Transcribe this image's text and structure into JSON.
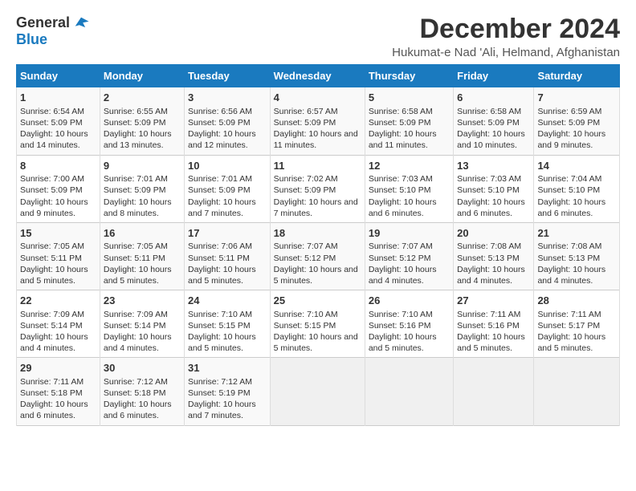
{
  "logo": {
    "line1": "General",
    "line2": "Blue"
  },
  "title": "December 2024",
  "subtitle": "Hukumat-e Nad 'Ali, Helmand, Afghanistan",
  "days_header": [
    "Sunday",
    "Monday",
    "Tuesday",
    "Wednesday",
    "Thursday",
    "Friday",
    "Saturday"
  ],
  "weeks": [
    [
      {
        "day": "1",
        "sunrise": "6:54 AM",
        "sunset": "5:09 PM",
        "daylight": "10 hours and 14 minutes."
      },
      {
        "day": "2",
        "sunrise": "6:55 AM",
        "sunset": "5:09 PM",
        "daylight": "10 hours and 13 minutes."
      },
      {
        "day": "3",
        "sunrise": "6:56 AM",
        "sunset": "5:09 PM",
        "daylight": "10 hours and 12 minutes."
      },
      {
        "day": "4",
        "sunrise": "6:57 AM",
        "sunset": "5:09 PM",
        "daylight": "10 hours and 11 minutes."
      },
      {
        "day": "5",
        "sunrise": "6:58 AM",
        "sunset": "5:09 PM",
        "daylight": "10 hours and 11 minutes."
      },
      {
        "day": "6",
        "sunrise": "6:58 AM",
        "sunset": "5:09 PM",
        "daylight": "10 hours and 10 minutes."
      },
      {
        "day": "7",
        "sunrise": "6:59 AM",
        "sunset": "5:09 PM",
        "daylight": "10 hours and 9 minutes."
      }
    ],
    [
      {
        "day": "8",
        "sunrise": "7:00 AM",
        "sunset": "5:09 PM",
        "daylight": "10 hours and 9 minutes."
      },
      {
        "day": "9",
        "sunrise": "7:01 AM",
        "sunset": "5:09 PM",
        "daylight": "10 hours and 8 minutes."
      },
      {
        "day": "10",
        "sunrise": "7:01 AM",
        "sunset": "5:09 PM",
        "daylight": "10 hours and 7 minutes."
      },
      {
        "day": "11",
        "sunrise": "7:02 AM",
        "sunset": "5:09 PM",
        "daylight": "10 hours and 7 minutes."
      },
      {
        "day": "12",
        "sunrise": "7:03 AM",
        "sunset": "5:10 PM",
        "daylight": "10 hours and 6 minutes."
      },
      {
        "day": "13",
        "sunrise": "7:03 AM",
        "sunset": "5:10 PM",
        "daylight": "10 hours and 6 minutes."
      },
      {
        "day": "14",
        "sunrise": "7:04 AM",
        "sunset": "5:10 PM",
        "daylight": "10 hours and 6 minutes."
      }
    ],
    [
      {
        "day": "15",
        "sunrise": "7:05 AM",
        "sunset": "5:11 PM",
        "daylight": "10 hours and 5 minutes."
      },
      {
        "day": "16",
        "sunrise": "7:05 AM",
        "sunset": "5:11 PM",
        "daylight": "10 hours and 5 minutes."
      },
      {
        "day": "17",
        "sunrise": "7:06 AM",
        "sunset": "5:11 PM",
        "daylight": "10 hours and 5 minutes."
      },
      {
        "day": "18",
        "sunrise": "7:07 AM",
        "sunset": "5:12 PM",
        "daylight": "10 hours and 5 minutes."
      },
      {
        "day": "19",
        "sunrise": "7:07 AM",
        "sunset": "5:12 PM",
        "daylight": "10 hours and 4 minutes."
      },
      {
        "day": "20",
        "sunrise": "7:08 AM",
        "sunset": "5:13 PM",
        "daylight": "10 hours and 4 minutes."
      },
      {
        "day": "21",
        "sunrise": "7:08 AM",
        "sunset": "5:13 PM",
        "daylight": "10 hours and 4 minutes."
      }
    ],
    [
      {
        "day": "22",
        "sunrise": "7:09 AM",
        "sunset": "5:14 PM",
        "daylight": "10 hours and 4 minutes."
      },
      {
        "day": "23",
        "sunrise": "7:09 AM",
        "sunset": "5:14 PM",
        "daylight": "10 hours and 4 minutes."
      },
      {
        "day": "24",
        "sunrise": "7:10 AM",
        "sunset": "5:15 PM",
        "daylight": "10 hours and 5 minutes."
      },
      {
        "day": "25",
        "sunrise": "7:10 AM",
        "sunset": "5:15 PM",
        "daylight": "10 hours and 5 minutes."
      },
      {
        "day": "26",
        "sunrise": "7:10 AM",
        "sunset": "5:16 PM",
        "daylight": "10 hours and 5 minutes."
      },
      {
        "day": "27",
        "sunrise": "7:11 AM",
        "sunset": "5:16 PM",
        "daylight": "10 hours and 5 minutes."
      },
      {
        "day": "28",
        "sunrise": "7:11 AM",
        "sunset": "5:17 PM",
        "daylight": "10 hours and 5 minutes."
      }
    ],
    [
      {
        "day": "29",
        "sunrise": "7:11 AM",
        "sunset": "5:18 PM",
        "daylight": "10 hours and 6 minutes."
      },
      {
        "day": "30",
        "sunrise": "7:12 AM",
        "sunset": "5:18 PM",
        "daylight": "10 hours and 6 minutes."
      },
      {
        "day": "31",
        "sunrise": "7:12 AM",
        "sunset": "5:19 PM",
        "daylight": "10 hours and 7 minutes."
      },
      null,
      null,
      null,
      null
    ]
  ]
}
